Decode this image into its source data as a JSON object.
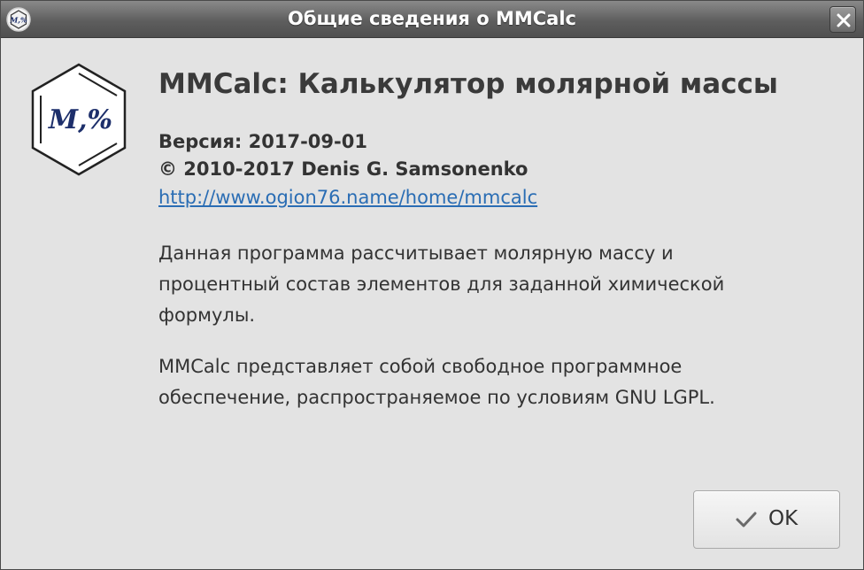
{
  "window": {
    "title": "Общие сведения о MMCalc",
    "title_icon_text": "M,%"
  },
  "logo": {
    "text": "M,%",
    "colors": {
      "text": "#1d2f6b",
      "outline": "#222222"
    }
  },
  "about": {
    "app_title": "MMCalc: Калькулятор молярной массы",
    "version_line": "Версия: 2017-09-01",
    "copyright_line": "© 2010-2017 Denis G. Samsonenko",
    "url": "http://www.ogion76.name/home/mmcalc",
    "description_lines": [
      "Данная программа рассчитывает молярную массу и",
      "процентный состав элементов для заданной химической",
      "формулы."
    ],
    "license_lines": [
      "MMCalc представляет собой свободное программное",
      "обеспечение, распространяемое по условиям GNU LGPL."
    ]
  },
  "buttons": {
    "ok_label": "OK",
    "ok_icon": "check-icon",
    "close_icon": "close-icon"
  },
  "colors": {
    "link": "#2a6db4",
    "titlebar": "#5e5e5e",
    "background": "#e3e3e3"
  }
}
